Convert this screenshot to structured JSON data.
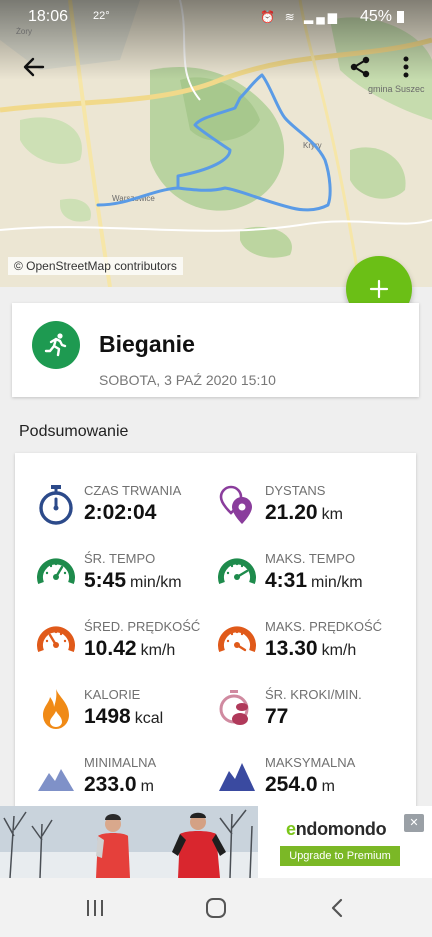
{
  "status_bar": {
    "time": "18:06",
    "temperature": "22°",
    "battery": "45%"
  },
  "map": {
    "attribution": "© OpenStreetMap contributors",
    "place_labels": [
      "Żory",
      "gmina Suszec",
      "Kryry",
      "Warszowice"
    ]
  },
  "activity": {
    "sport": "Bieganie",
    "datetime": "SOBOTA, 3 PAŹ 2020 15:10"
  },
  "summary": {
    "title": "Podsumowanie",
    "stats": [
      {
        "label": "CZAS TRWANIA",
        "value": "2:02:04",
        "unit": "",
        "icon": "stopwatch-icon"
      },
      {
        "label": "DYSTANS",
        "value": "21.20",
        "unit": "km",
        "icon": "location-pins-icon"
      },
      {
        "label": "ŚR. TEMPO",
        "value": "5:45",
        "unit": "min/km",
        "icon": "avg-pace-gauge-icon"
      },
      {
        "label": "MAKS. TEMPO",
        "value": "4:31",
        "unit": "min/km",
        "icon": "max-pace-gauge-icon"
      },
      {
        "label": "ŚRED. PRĘDKOŚĆ",
        "value": "10.42",
        "unit": "km/h",
        "icon": "avg-speed-gauge-icon"
      },
      {
        "label": "MAKS. PRĘDKOŚĆ",
        "value": "13.30",
        "unit": "km/h",
        "icon": "max-speed-gauge-icon"
      },
      {
        "label": "KALORIE",
        "value": "1498",
        "unit": "kcal",
        "icon": "flame-icon"
      },
      {
        "label": "ŚR. KROKI/MIN.",
        "value": "77",
        "unit": "",
        "icon": "steps-icon"
      },
      {
        "label": "MINIMALNA",
        "value": "233.0",
        "unit": "m",
        "icon": "min-altitude-icon"
      },
      {
        "label": "MAKSYMALNA",
        "value": "254.0",
        "unit": "m",
        "icon": "max-altitude-icon"
      }
    ]
  },
  "ad": {
    "brand_first": "e",
    "brand_rest": "ndomondo",
    "cta": "Upgrade to Premium"
  },
  "colors": {
    "fab": "#6bbf16",
    "sport_circle": "#1e9a51",
    "route": "#5a9be6",
    "stopwatch": "#2c4a8a",
    "pins": "#8a3d9c",
    "pace": "#1e8b4c",
    "speed": "#e05a1a",
    "calories": "#f08a16",
    "steps": "#b0395a",
    "altitude": "#3a4aa0"
  }
}
